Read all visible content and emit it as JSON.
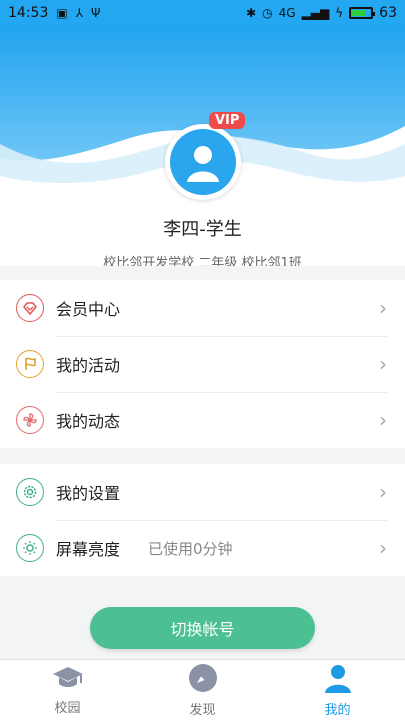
{
  "status_bar": {
    "time": "14:53",
    "battery": "63",
    "network": "4G"
  },
  "profile": {
    "vip_badge": "VIP",
    "name": "李四-学生",
    "school_info": "校比邻开发学校 二年级 校比邻1班"
  },
  "menu_group_1": [
    {
      "label": "会员中心",
      "icon": "heart-diamond-icon",
      "color": "#e15a5a"
    },
    {
      "label": "我的活动",
      "icon": "flag-icon",
      "color": "#e0a22f"
    },
    {
      "label": "我的动态",
      "icon": "pinwheel-icon",
      "color": "#e16a6a"
    }
  ],
  "menu_group_2": [
    {
      "label": "我的设置",
      "icon": "gear-icon",
      "color": "#3fae8c"
    },
    {
      "label": "屏幕亮度",
      "sub": "已使用0分钟",
      "icon": "sun-icon",
      "color": "#3fae8c"
    }
  ],
  "switch_account_label": "切换帐号",
  "tabbar": [
    {
      "label": "校园",
      "icon": "graduation-cap-icon"
    },
    {
      "label": "发现",
      "icon": "compass-icon"
    },
    {
      "label": "我的",
      "icon": "person-icon",
      "active": true
    }
  ],
  "colors": {
    "primary_blue": "#22a7f0",
    "accent_green": "#4cbf93",
    "vip_red": "#ef4b4b"
  }
}
